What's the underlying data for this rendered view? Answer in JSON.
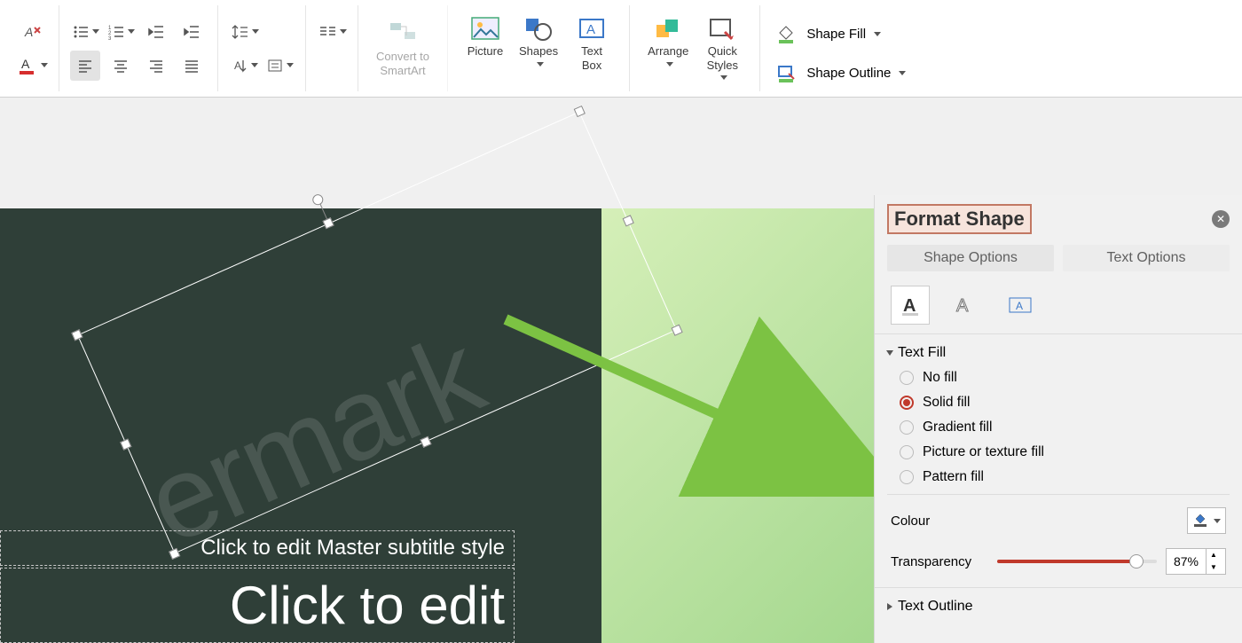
{
  "ribbon": {
    "convert_label": "Convert to\nSmartArt",
    "picture": "Picture",
    "shapes": "Shapes",
    "textbox": "Text\nBox",
    "arrange": "Arrange",
    "quickstyles": "Quick\nStyles",
    "shape_fill": "Shape Fill",
    "shape_outline": "Shape Outline"
  },
  "slide": {
    "subtitle_placeholder": "Click to edit Master subtitle style",
    "title_placeholder": "Click to edit",
    "watermark_text": "ermark"
  },
  "panel": {
    "title": "Format Shape",
    "tabs": {
      "shape": "Shape Options",
      "text": "Text Options"
    },
    "section_fill": "Text Fill",
    "section_outline": "Text Outline",
    "fill_options": {
      "none": "No fill",
      "solid": "Solid fill",
      "gradient": "Gradient fill",
      "picture": "Picture or texture fill",
      "pattern": "Pattern fill"
    },
    "colour_label": "Colour",
    "transparency_label": "Transparency",
    "transparency_value": "87%",
    "transparency_pct": 87
  }
}
